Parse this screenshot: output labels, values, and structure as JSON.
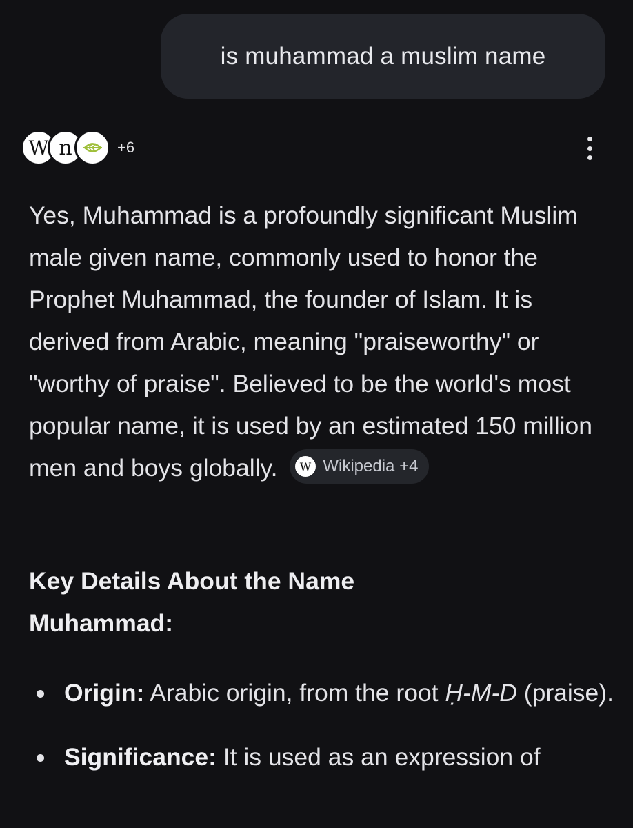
{
  "user_query": "is muhammad a muslim name",
  "sources": {
    "icons": [
      "wikipedia-icon",
      "wn-icon",
      "leaf-icon"
    ],
    "wikipedia_letter": "W",
    "wn_letters": "n",
    "more_count": "+6"
  },
  "answer": {
    "text": "Yes, Muhammad is a profoundly significant Muslim male given name, commonly used to honor the Prophet Muhammad, the founder of Islam. It is derived from Arabic, meaning \"praiseworthy\" or \"worthy of praise\". Believed to be the world's most popular name, it is used by an estimated 150 million men and boys globally.",
    "citation": {
      "icon_letter": "W",
      "label": "Wikipedia +4"
    }
  },
  "key_details": {
    "heading": "Key Details About the Name Muhammad:",
    "items": [
      {
        "label": "Origin:",
        "text_before": " Arabic origin, from the root ",
        "italic": "Ḥ-M-D",
        "text_after": " (praise)."
      },
      {
        "label": "Significance:",
        "text_before": " It is used as an expression of",
        "italic": "",
        "text_after": ""
      }
    ]
  },
  "colors": {
    "background": "#111114",
    "bubble": "#23252b",
    "chip": "#24262b",
    "text": "#e4e4e8"
  }
}
